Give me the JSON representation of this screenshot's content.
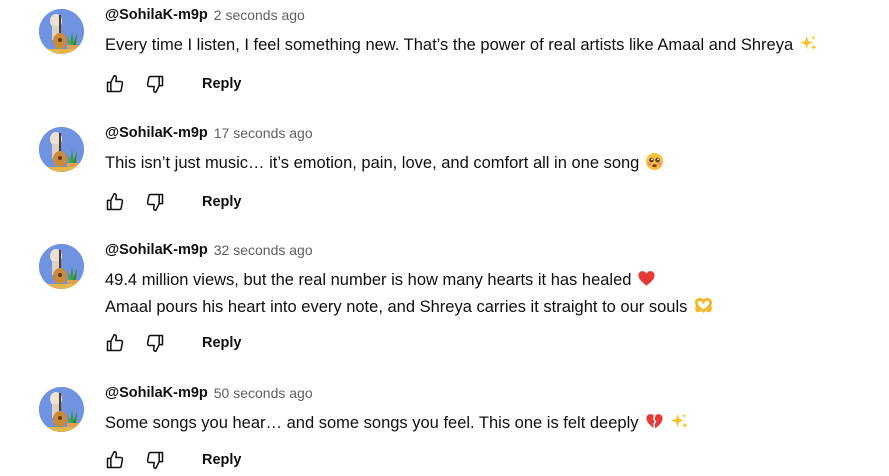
{
  "reply_label": "Reply",
  "colors": {
    "avatar_bg": "#6f93e0",
    "author": "#0f0f0f",
    "timestamp": "#606060",
    "heart": "#e53935"
  },
  "comments": [
    {
      "author": "@SohilaK-m9p",
      "timestamp": "2 seconds ago",
      "lines": [
        "Every time I listen, I feel something new. That’s the power of real artists like Amaal and Shreya"
      ],
      "emojis": [
        "sparkles-emoji"
      ]
    },
    {
      "author": "@SohilaK-m9p",
      "timestamp": "17 seconds ago",
      "lines": [
        "This isn’t just music… it’s emotion, pain, love, and comfort all in one song"
      ],
      "emojis": [
        "crying-face-emoji"
      ]
    },
    {
      "author": "@SohilaK-m9p",
      "timestamp": "32 seconds ago",
      "lines": [
        "49.4 million views, but the real number is how many hearts it has healed",
        "Amaal pours his heart into every note, and Shreya carries it straight to our souls"
      ],
      "emojis": [
        "red-heart-emoji",
        "heart-hands-emoji"
      ]
    },
    {
      "author": "@SohilaK-m9p",
      "timestamp": "50 seconds ago",
      "lines": [
        "Some songs you hear… and some songs you feel. This one is felt deeply"
      ],
      "emojis": [
        "broken-heart-emoji",
        "sparkles-emoji"
      ]
    }
  ]
}
